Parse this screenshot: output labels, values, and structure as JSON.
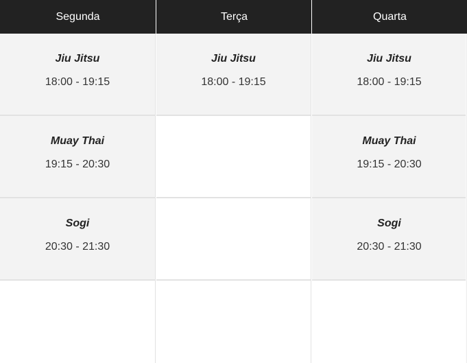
{
  "days": [
    "Segunda",
    "Terça",
    "Quarta"
  ],
  "rows": [
    [
      {
        "name": "Jiu Jitsu",
        "time": "18:00 - 19:15"
      },
      {
        "name": "Jiu Jitsu",
        "time": "18:00 - 19:15"
      },
      {
        "name": "Jiu Jitsu",
        "time": "18:00 - 19:15"
      }
    ],
    [
      {
        "name": "Muay Thai",
        "time": "19:15 - 20:30"
      },
      {
        "name": "",
        "time": ""
      },
      {
        "name": "Muay Thai",
        "time": "19:15 - 20:30"
      }
    ],
    [
      {
        "name": "Sogi",
        "time": "20:30 - 21:30"
      },
      {
        "name": "",
        "time": ""
      },
      {
        "name": "Sogi",
        "time": "20:30 - 21:30"
      }
    ],
    [
      {
        "name": "",
        "time": ""
      },
      {
        "name": "",
        "time": ""
      },
      {
        "name": "",
        "time": ""
      }
    ]
  ],
  "colors": {
    "header_bg": "#222222",
    "header_text": "#ffffff",
    "filled_cell_bg": "#f3f3f3",
    "empty_cell_bg": "#ffffff",
    "grid_line": "#e2e2e2"
  }
}
